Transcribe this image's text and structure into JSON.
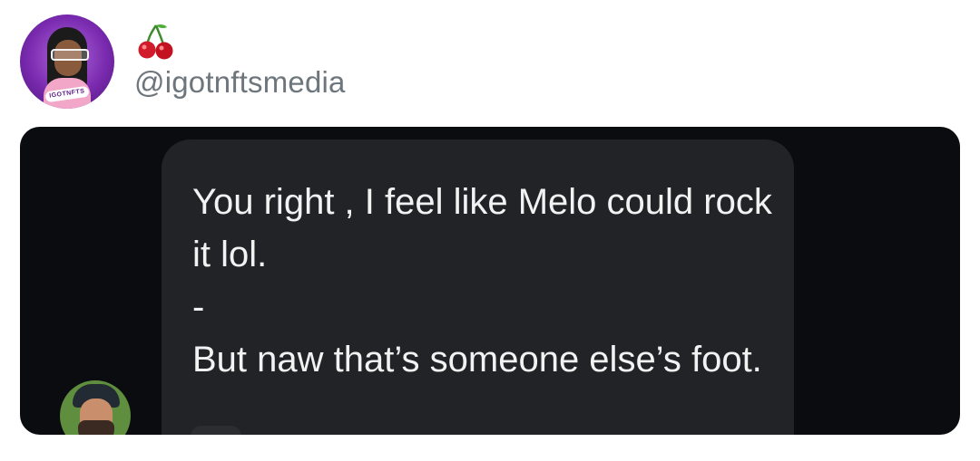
{
  "tweet": {
    "author_emoji": "cherries-emoji",
    "handle": "@igotnftsmedia",
    "avatar_badge_text": "IGOTNFTS"
  },
  "screenshot": {
    "message_lines": [
      "You right , I feel like Melo could rock it lol.",
      "-",
      "But naw that’s someone else’s foot."
    ]
  },
  "colors": {
    "handle": "#6e767d",
    "media_background": "#0b0c0f",
    "bubble": "#212327",
    "message_text": "#f2f2f2",
    "avatar_purple": "#7a2bb0"
  }
}
